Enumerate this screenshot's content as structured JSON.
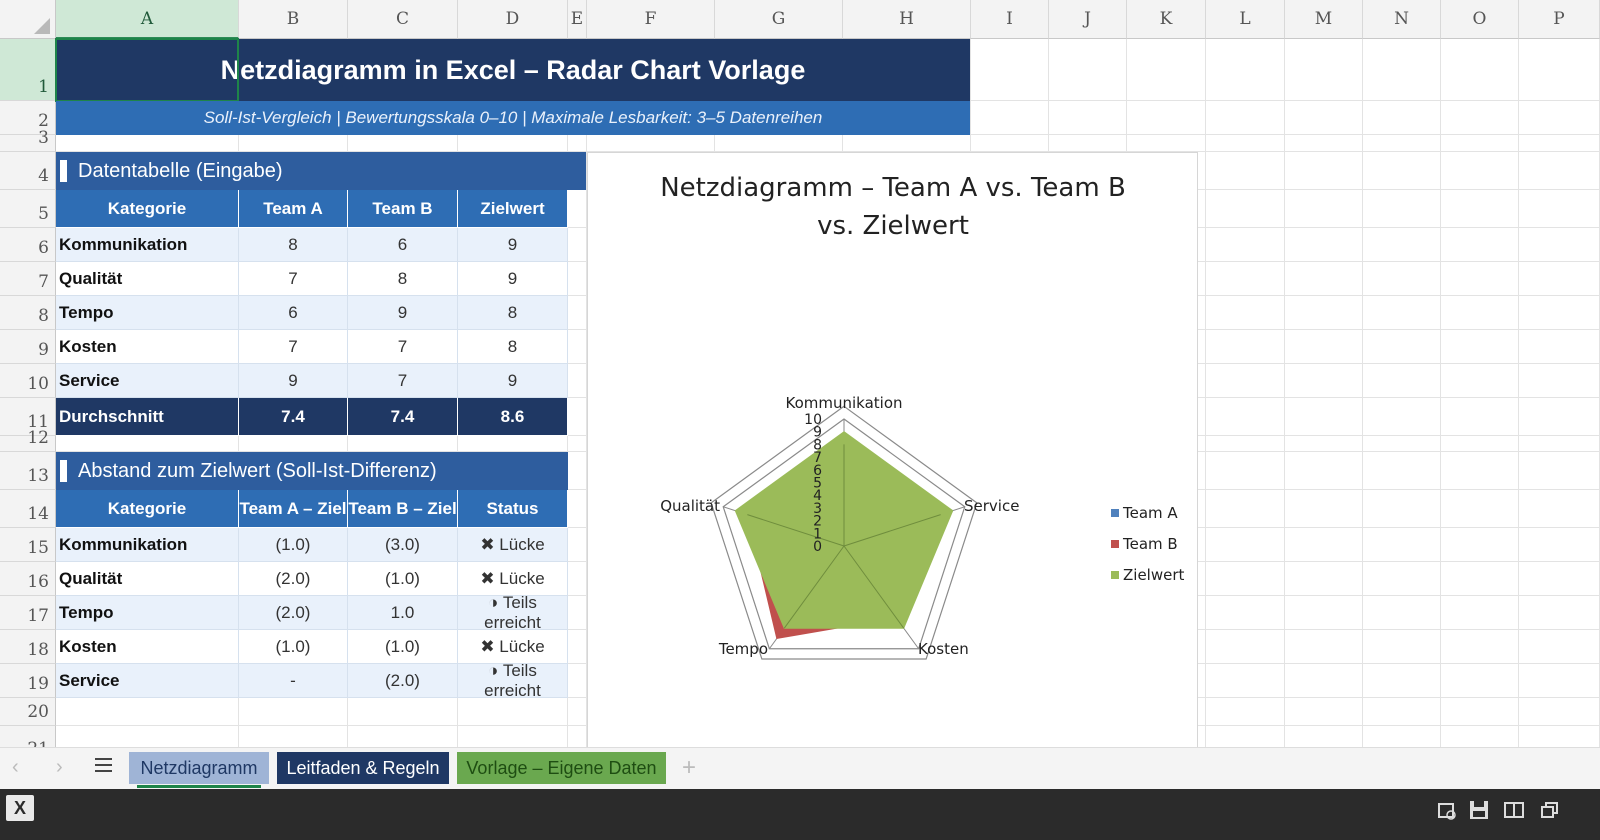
{
  "columns": [
    "A",
    "B",
    "C",
    "D",
    "E",
    "F",
    "G",
    "H",
    "I",
    "J",
    "K",
    "L",
    "M",
    "N",
    "O",
    "P"
  ],
  "rows": [
    "1",
    "2",
    "3",
    "4",
    "5",
    "6",
    "7",
    "8",
    "9",
    "10",
    "11",
    "12",
    "13",
    "14",
    "15",
    "16",
    "17",
    "18",
    "19",
    "20",
    "21"
  ],
  "title": "Netzdiagramm in Excel – Radar Chart Vorlage",
  "subtitle": "Soll-Ist-Vergleich | Bewertungsskala 0–10 | Maximale Lesbarkeit: 3–5 Datenreihen",
  "section1": {
    "title": "Datentabelle (Eingabe)",
    "headers": [
      "Kategorie",
      "Team A",
      "Team B",
      "Zielwert"
    ],
    "rows": [
      [
        "Kommunikation",
        "8",
        "6",
        "9"
      ],
      [
        "Qualität",
        "7",
        "8",
        "9"
      ],
      [
        "Tempo",
        "6",
        "9",
        "8"
      ],
      [
        "Kosten",
        "7",
        "7",
        "8"
      ],
      [
        "Service",
        "9",
        "7",
        "9"
      ]
    ],
    "average": [
      "Durchschnitt",
      "7.4",
      "7.4",
      "8.6"
    ]
  },
  "section2": {
    "title": "Abstand zum Zielwert (Soll-Ist-Differenz)",
    "headers": [
      "Kategorie",
      "Team A – Ziel",
      "Team B – Ziel",
      "Status"
    ],
    "rows": [
      [
        "Kommunikation",
        "(1.0)",
        "(3.0)",
        "✖ Lücke"
      ],
      [
        "Qualität",
        "(2.0)",
        "(1.0)",
        "✖ Lücke"
      ],
      [
        "Tempo",
        "(2.0)",
        "1.0",
        "◑ Teils erreicht"
      ],
      [
        "Kosten",
        "(1.0)",
        "(1.0)",
        "✖ Lücke"
      ],
      [
        "Service",
        "-",
        "(2.0)",
        "◑ Teils erreicht"
      ]
    ]
  },
  "chart_data": {
    "type": "radar",
    "title": "Netzdiagramm – Team A vs. Team B vs. Zielwert",
    "categories": [
      "Kommunikation",
      "Service",
      "Kosten",
      "Tempo",
      "Qualität"
    ],
    "rlim": [
      0,
      10
    ],
    "ticks": [
      "0",
      "1",
      "2",
      "3",
      "4",
      "5",
      "6",
      "7",
      "8",
      "9",
      "10"
    ],
    "series": [
      {
        "name": "Team A",
        "color": "#4f81bd",
        "values": [
          8,
          9,
          7,
          6,
          7
        ]
      },
      {
        "name": "Team B",
        "color": "#c0504d",
        "values": [
          6,
          7,
          7,
          9,
          8
        ]
      },
      {
        "name": "Zielwert",
        "color": "#9bbb59",
        "values": [
          9,
          9,
          8,
          8,
          9
        ]
      }
    ],
    "legend": "right"
  },
  "tabs": [
    {
      "label": "Netzdiagramm",
      "bg": "#9fb4d6",
      "fg": "#1f3864"
    },
    {
      "label": "Leitfaden & Regeln",
      "bg": "#1f3864",
      "fg": "#ffffff"
    },
    {
      "label": "Vorlage – Eigene Daten",
      "bg": "#6aa84f",
      "fg": "#1e4d12"
    }
  ],
  "tab_add": "+",
  "app_icon": "X"
}
